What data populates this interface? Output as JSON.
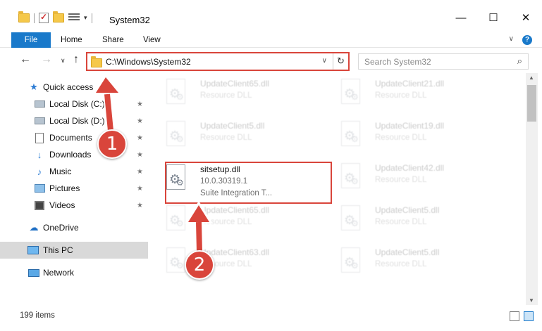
{
  "window": {
    "title": "System32",
    "qat_arrow": "▾",
    "controls": {
      "minimize": "—",
      "maximize": "☐",
      "close": "✕"
    }
  },
  "ribbon": {
    "tabs": [
      "File",
      "Home",
      "Share",
      "View"
    ],
    "expand_glyph": "∨",
    "help_glyph": "?"
  },
  "navigation": {
    "back": "←",
    "forward": "→",
    "recent": "∨",
    "up": "↑",
    "address": "C:\\Windows\\System32",
    "address_dropdown": "∨",
    "refresh": "↻",
    "search_placeholder": "Search System32",
    "search_icon": "⌕"
  },
  "sidebar": {
    "pin_glyph": "★",
    "items": [
      {
        "label": "Quick access",
        "icon": "star-icon",
        "pinned": false
      },
      {
        "label": "Local Disk (C:)",
        "icon": "disk-icon",
        "pinned": true
      },
      {
        "label": "Local Disk (D:)",
        "icon": "disk-icon",
        "pinned": true
      },
      {
        "label": "Documents",
        "icon": "documents-icon",
        "pinned": true
      },
      {
        "label": "Downloads",
        "icon": "download-icon",
        "pinned": true
      },
      {
        "label": "Music",
        "icon": "music-icon",
        "pinned": true
      },
      {
        "label": "Pictures",
        "icon": "pictures-icon",
        "pinned": true
      },
      {
        "label": "Videos",
        "icon": "videos-icon",
        "pinned": true
      },
      {
        "label": "OneDrive",
        "icon": "cloud-icon",
        "pinned": false
      },
      {
        "label": "This PC",
        "icon": "computer-icon",
        "pinned": false,
        "selected": true
      },
      {
        "label": "Network",
        "icon": "network-icon",
        "pinned": false
      }
    ]
  },
  "files": [
    {
      "name": "UpdateClient65.dll",
      "line1": "Resource DLL",
      "line2": "",
      "faded": true
    },
    {
      "name": "UpdateClient21.dll",
      "line1": "Resource DLL",
      "line2": "",
      "faded": true
    },
    {
      "name": "UpdateClient5.dll",
      "line1": "Resource DLL",
      "line2": "",
      "faded": true
    },
    {
      "name": "UpdateClient19.dll",
      "line1": "Resource DLL",
      "line2": "",
      "faded": true
    },
    {
      "name": "sitsetup.dll",
      "line1": "10.0.30319.1",
      "line2": "Suite Integration T...",
      "faded": false
    },
    {
      "name": "UpdateClient42.dll",
      "line1": "Resource DLL",
      "line2": "",
      "faded": true
    },
    {
      "name": "UpdateClient65.dll",
      "line1": "Resource DLL",
      "line2": "",
      "faded": true
    },
    {
      "name": "UpdateClient5.dll",
      "line1": "Resource DLL",
      "line2": "",
      "faded": true
    },
    {
      "name": "UpdateClient63.dll",
      "line1": "Resource DLL",
      "line2": "",
      "faded": true
    },
    {
      "name": "UpdateClient5.dll",
      "line1": "Resource DLL",
      "line2": "",
      "faded": true
    }
  ],
  "scrollbar": {
    "up": "▲",
    "down": "▼"
  },
  "status": {
    "item_count": "199 items"
  },
  "annotations": {
    "callout_1": "1",
    "callout_2": "2",
    "color": "#d9453b"
  }
}
